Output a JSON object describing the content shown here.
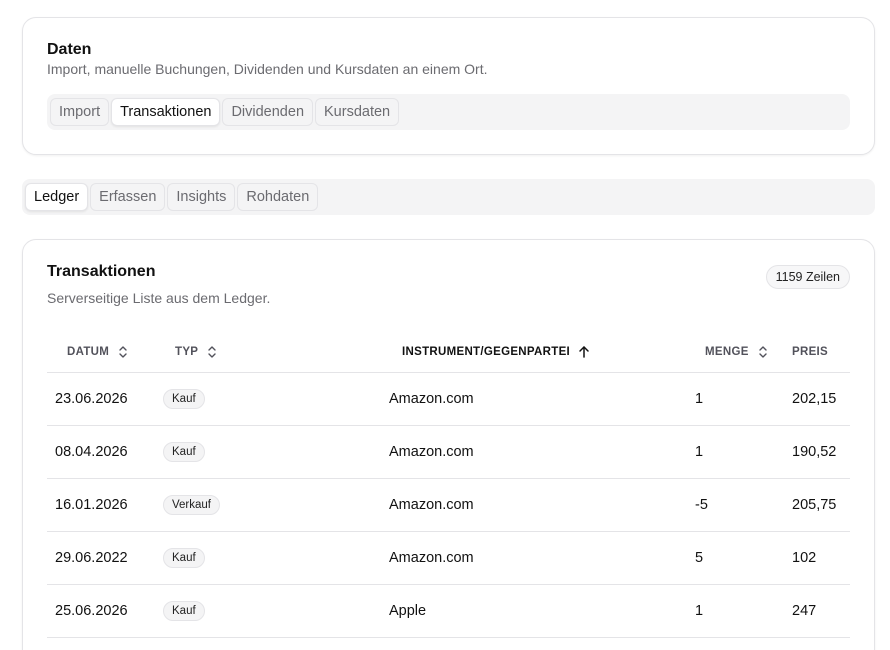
{
  "daten_card": {
    "title": "Daten",
    "subtitle": "Import, manuelle Buchungen, Dividenden und Kursdaten an einem Ort.",
    "tabs": [
      {
        "label": "Import",
        "active": false
      },
      {
        "label": "Transaktionen",
        "active": true
      },
      {
        "label": "Dividenden",
        "active": false
      },
      {
        "label": "Kursdaten",
        "active": false
      }
    ]
  },
  "main_tabs": [
    {
      "label": "Ledger",
      "active": true
    },
    {
      "label": "Erfassen",
      "active": false
    },
    {
      "label": "Insights",
      "active": false
    },
    {
      "label": "Rohdaten",
      "active": false
    }
  ],
  "transactions": {
    "title": "Transaktionen",
    "subtitle": "Serverseitige Liste aus dem Ledger.",
    "row_count": "1159 Zeilen",
    "columns": {
      "datum": "DATUM",
      "typ": "TYP",
      "instrument": "INSTRUMENT/GEGENPARTEI",
      "menge": "MENGE",
      "preis": "PREIS"
    },
    "sort_icons": {
      "unsorted": "chevrons-up-down-icon",
      "sorted_asc": "arrow-up-icon"
    },
    "rows": [
      {
        "datum": "23.06.2026",
        "typ": "Kauf",
        "instrument": "Amazon.com",
        "menge": "1",
        "preis": "202,15"
      },
      {
        "datum": "08.04.2026",
        "typ": "Kauf",
        "instrument": "Amazon.com",
        "menge": "1",
        "preis": "190,52"
      },
      {
        "datum": "16.01.2026",
        "typ": "Verkauf",
        "instrument": "Amazon.com",
        "menge": "-5",
        "preis": "205,75"
      },
      {
        "datum": "29.06.2022",
        "typ": "Kauf",
        "instrument": "Amazon.com",
        "menge": "5",
        "preis": "102"
      },
      {
        "datum": "25.06.2026",
        "typ": "Kauf",
        "instrument": "Apple",
        "menge": "1",
        "preis": "247"
      }
    ]
  }
}
